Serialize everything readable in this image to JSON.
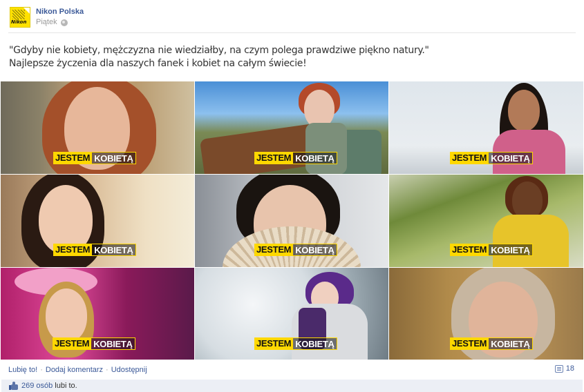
{
  "post": {
    "page_name": "Nikon Polska",
    "date": "Piątek",
    "logo_text": "Nikon",
    "privacy_icon": "globe-icon",
    "text_line1": "\"Gdyby nie kobiety, mężczyzna nie wiedziałby, na czym polega prawdziwe piękno natury.\"",
    "text_line2": "Najlepsze życzenia dla naszych fanek i kobiet na całym świecie!"
  },
  "tiles": [
    {
      "badge_a": "JESTEM",
      "badge_b": "KOBIETĄ"
    },
    {
      "badge_a": "JESTEM",
      "badge_b": "KOBIETĄ"
    },
    {
      "badge_a": "JESTEM",
      "badge_b": "KOBIETĄ"
    },
    {
      "badge_a": "JESTEM",
      "badge_b": "KOBIETĄ"
    },
    {
      "badge_a": "JESTEM",
      "badge_b": "KOBIETĄ"
    },
    {
      "badge_a": "JESTEM",
      "badge_b": "KOBIETĄ"
    },
    {
      "badge_a": "JESTEM",
      "badge_b": "KOBIETĄ"
    },
    {
      "badge_a": "JESTEM",
      "badge_b": "KOBIETĄ"
    },
    {
      "badge_a": "JESTEM",
      "badge_b": "KOBIETĄ"
    }
  ],
  "actions": {
    "like": "Lubię to!",
    "comment": "Dodaj komentarz",
    "share": "Udostępnij",
    "separator": "·",
    "comment_count": "18"
  },
  "likes": {
    "count": "269 osób",
    "suffix": "lubi to."
  },
  "colors": {
    "link": "#3b5998",
    "badge_yellow": "#ffd800",
    "likes_bar": "#eceff5"
  }
}
